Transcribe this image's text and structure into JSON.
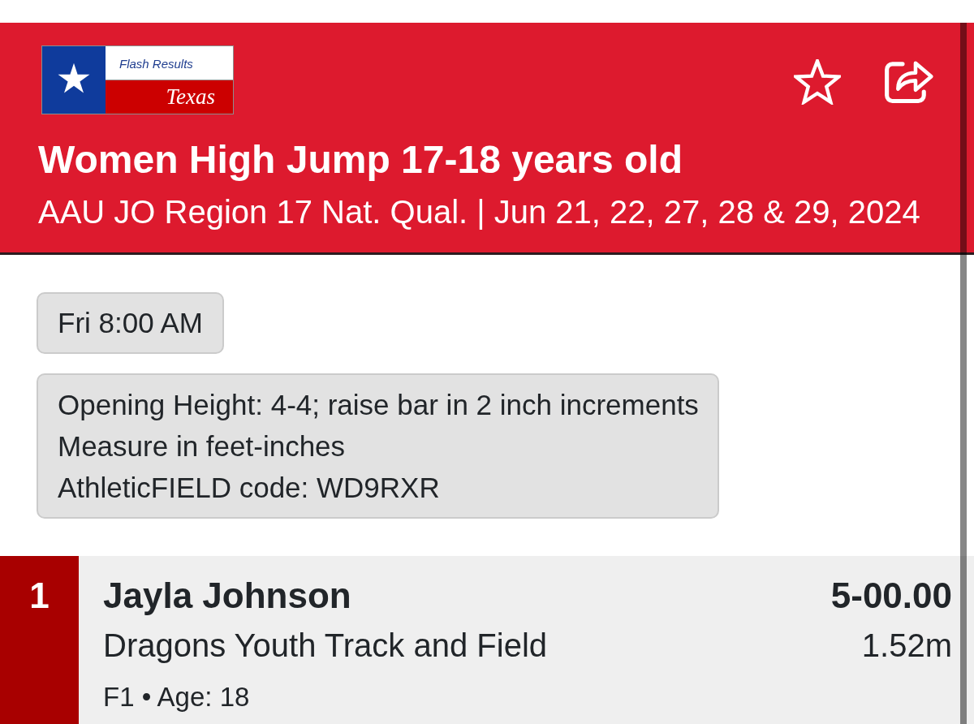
{
  "header": {
    "logo": {
      "line_1": "Flash Results",
      "line_2": "Texas"
    },
    "title": "Women High Jump 17-18 years old",
    "subtitle": "AAU JO Region 17 Nat. Qual. | Jun 21, 22, 27, 28 & 29, 2024"
  },
  "session": {
    "time": "Fri 8:00 AM"
  },
  "event_notes": [
    "Opening Height: 4-4; raise bar in 2 inch increments",
    "Measure in feet-inches",
    "AthleticFIELD code: WD9RXR"
  ],
  "results": [
    {
      "place": "1",
      "name": "Jayla Johnson",
      "team": "Dragons Youth Track and Field",
      "details": "F1 • Age: 18",
      "mark": "5-00.00",
      "mark_metric": "1.52m"
    }
  ]
}
